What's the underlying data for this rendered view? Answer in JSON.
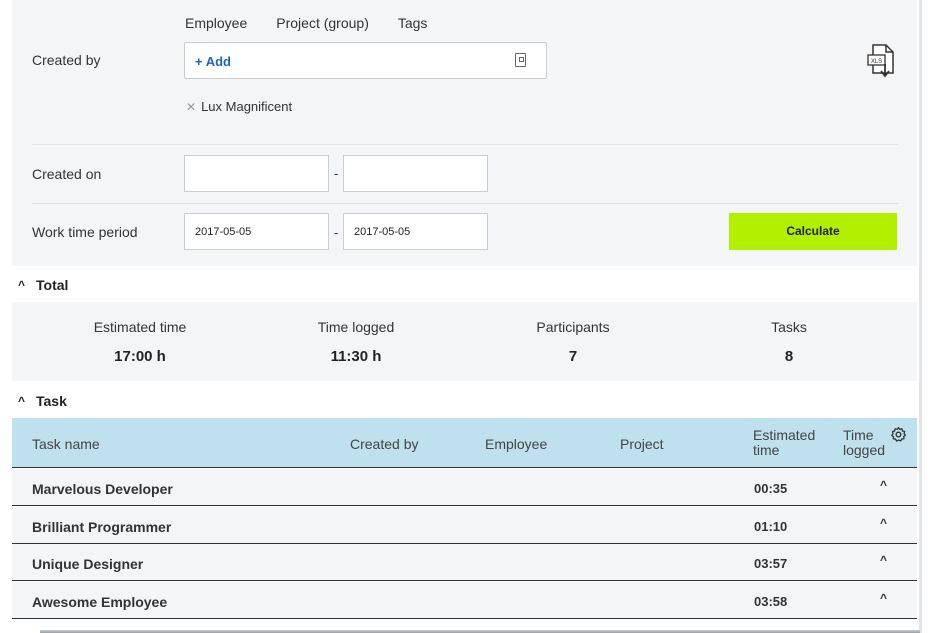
{
  "filter": {
    "tabs": [
      "Employee",
      "Project (group)",
      "Tags"
    ],
    "created_by_label": "Created by",
    "add_label": "+ Add",
    "chips": [
      "Lux Magnificent"
    ],
    "created_on_label": "Created on",
    "created_on_from": "",
    "created_on_to": "",
    "work_time_label": "Work time period",
    "work_time_from": "2017-05-05",
    "work_time_to": "2017-05-05",
    "dash": "-",
    "calculate_label": "Calculate",
    "export_icon_text": "XLS"
  },
  "total": {
    "title": "Total",
    "stats": [
      {
        "label": "Estimated time",
        "value": "17:00 h"
      },
      {
        "label": "Time logged",
        "value": "11:30 h"
      },
      {
        "label": "Participants",
        "value": "7"
      },
      {
        "label": "Tasks",
        "value": "8"
      }
    ]
  },
  "task": {
    "title": "Task",
    "columns": {
      "task_name": "Task name",
      "created_by": "Created by",
      "employee": "Employee",
      "project": "Project",
      "estimated": "Estimated time",
      "logged": "Time logged"
    },
    "rows": [
      {
        "name": "Marvelous Developer",
        "estimated": "00:35"
      },
      {
        "name": "Brilliant Programmer",
        "estimated": "01:10"
      },
      {
        "name": "Unique Designer",
        "estimated": "03:57"
      },
      {
        "name": "Awesome Employee",
        "estimated": "03:58"
      }
    ]
  },
  "colors": {
    "accent_button": "#b2ef00",
    "table_header": "#bfe0ed",
    "link": "#2066b0"
  }
}
